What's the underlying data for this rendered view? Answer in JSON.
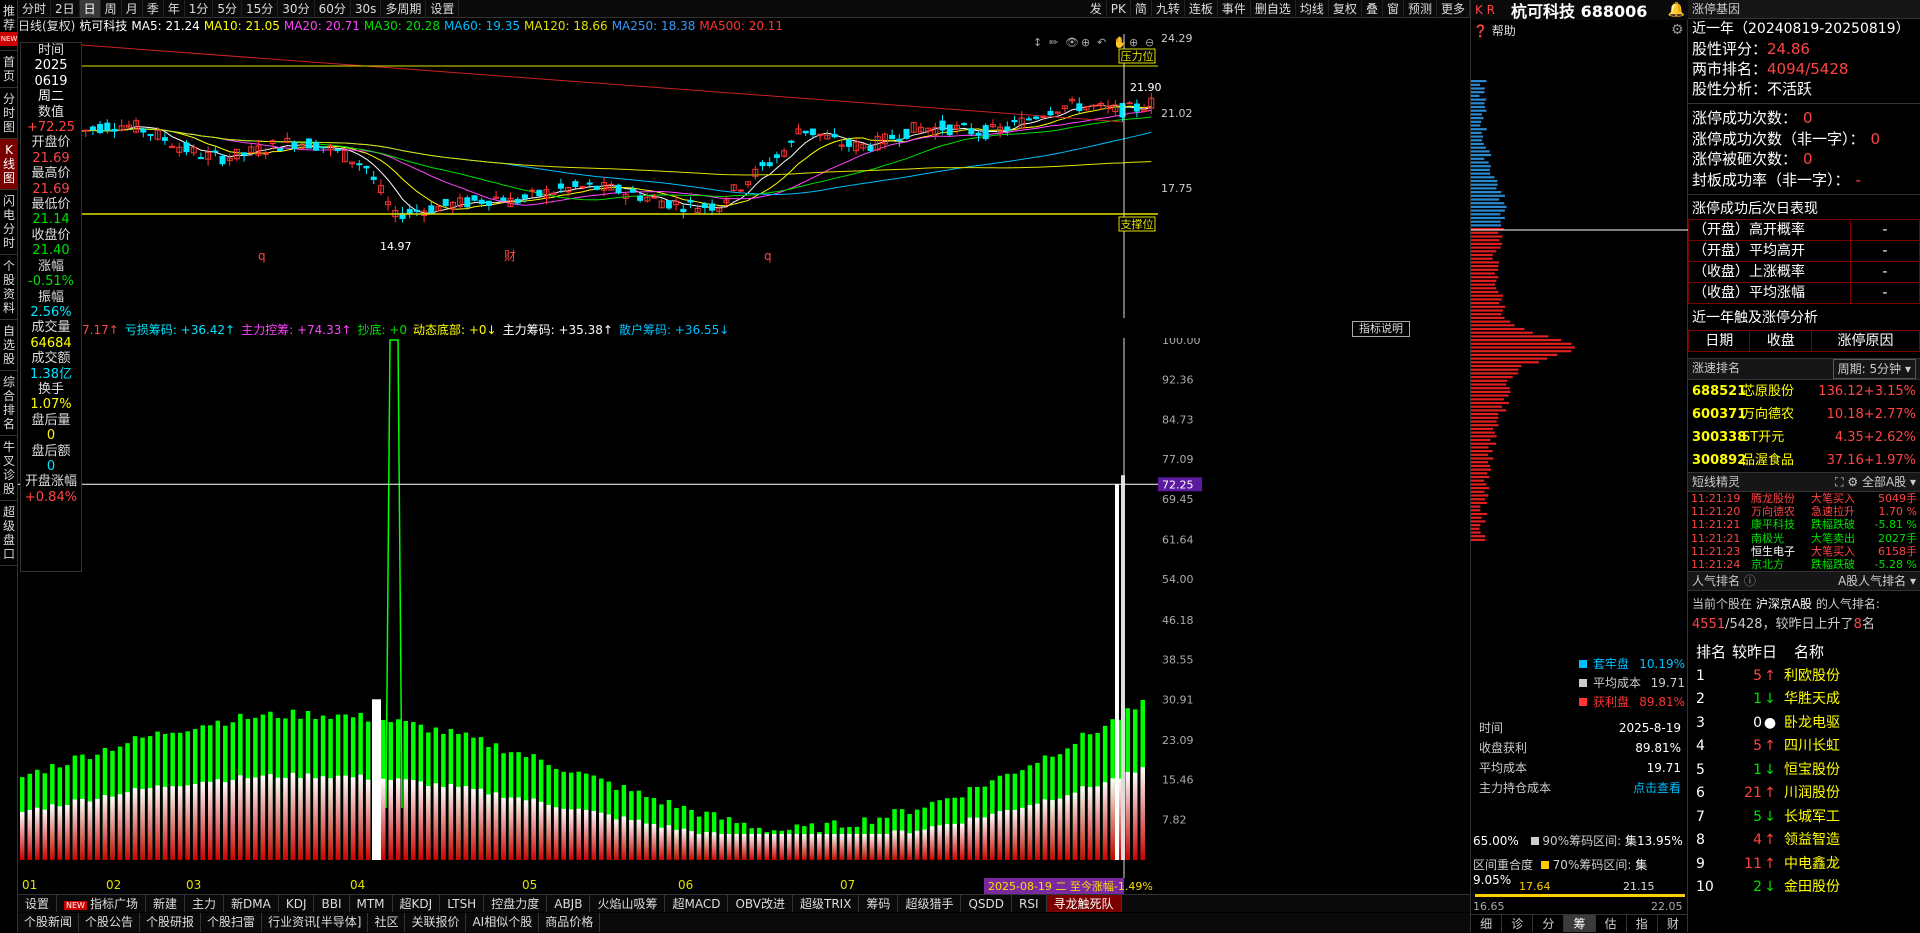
{
  "leftnav": [
    {
      "label": "推荐",
      "badge": "NEW"
    },
    {
      "label": "首页"
    },
    {
      "label": "分时图"
    },
    {
      "label": "K线图",
      "active": true
    },
    {
      "label": "闪电分时"
    },
    {
      "label": "个股资料"
    },
    {
      "label": "自选股"
    },
    {
      "label": "综合排名"
    },
    {
      "label": "牛叉诊股"
    },
    {
      "label": "超级盘口"
    }
  ],
  "toolbar": {
    "left": [
      "分时",
      "2日",
      "日",
      "周",
      "月",
      "季",
      "年",
      "1分",
      "5分",
      "15分",
      "30分",
      "60分",
      "30s",
      "多周期",
      "设置"
    ],
    "selected": "日",
    "right": [
      "发",
      "PK",
      "简",
      "九转",
      "连板",
      "事件",
      "删自选",
      "均线",
      "复权",
      "叠",
      "窗",
      "预测",
      "更多"
    ]
  },
  "maline": {
    "period": "日线(复权)",
    "name": "杭可科技",
    "items": [
      {
        "label": "MA5: 21.24",
        "color": "#ffffff"
      },
      {
        "label": "MA10: 21.05",
        "color": "#ffff00"
      },
      {
        "label": "MA20: 20.71",
        "color": "#ff44ff"
      },
      {
        "label": "MA30: 20.28",
        "color": "#00e000"
      },
      {
        "label": "MA60: 19.35",
        "color": "#00bfff"
      },
      {
        "label": "MA120: 18.66",
        "color": "#e0e000"
      },
      {
        "label": "MA250: 18.38",
        "color": "#3399ff"
      },
      {
        "label": "MA500: 20.11",
        "color": "#ff3333"
      }
    ]
  },
  "info": {
    "fields": [
      {
        "label": "时间",
        "value": "2025",
        "value2": "0619",
        "value3": "周二"
      },
      {
        "label": "数值",
        "value": "+72.25",
        "cls": "up"
      },
      {
        "label": "开盘价",
        "value": "21.69",
        "cls": "up"
      },
      {
        "label": "最高价",
        "value": "21.69",
        "cls": "up"
      },
      {
        "label": "最低价",
        "value": "21.14",
        "cls": "dn"
      },
      {
        "label": "收盘价",
        "value": "21.40",
        "cls": "dn"
      },
      {
        "label": "涨幅",
        "value": "-0.51%",
        "cls": "dn"
      },
      {
        "label": "振幅",
        "value": "2.56%",
        "cls": "cyan"
      },
      {
        "label": "成交量",
        "value": "64684",
        "cls": "yel"
      },
      {
        "label": "成交额",
        "value": "1.38亿",
        "cls": "cyan"
      },
      {
        "label": "换手",
        "value": "1.07%",
        "cls": "yel"
      },
      {
        "label": "盘后量",
        "value": "0",
        "cls": "yel"
      },
      {
        "label": "盘后额",
        "value": "0",
        "cls": "cyan"
      },
      {
        "label": "开盘涨幅",
        "value": "+0.84%",
        "cls": "up"
      }
    ]
  },
  "mainchart": {
    "yticks": [
      "24.29",
      "21.02",
      "17.75"
    ],
    "pressure_label": "压力位",
    "support_label": "支撑位",
    "high_label": "21.90",
    "low_label": "14.97",
    "months": [
      "q",
      "财",
      "q"
    ]
  },
  "indicator": {
    "title_items": [
      {
        "label": "7.17↑",
        "color": "#ff4444"
      },
      {
        "label": "亏损筹码: +36.42↑",
        "color": "#00e5ff"
      },
      {
        "label": "主力控筹: +74.33↑",
        "color": "#ff44ff"
      },
      {
        "label": "抄底: +0",
        "color": "#00e000"
      },
      {
        "label": "动态底部: +0↓",
        "color": "#ffff00"
      },
      {
        "label": "主力筹码: +35.38↑",
        "color": "#ffffff"
      },
      {
        "label": "散户筹码: +36.55↓",
        "color": "#00bfff"
      }
    ],
    "explain_label": "指标说明",
    "yticks": [
      "100.00",
      "92.36",
      "84.73",
      "77.09",
      "72.25",
      "69.45",
      "61.64",
      "54.00",
      "46.18",
      "38.55",
      "30.91",
      "23.09",
      "15.46",
      "7.82"
    ],
    "months": [
      "01",
      "02",
      "03",
      "04",
      "05",
      "06",
      "07"
    ],
    "date_tag": "2025-08-19 二 至今涨幅-1.49%"
  },
  "tabs1": [
    "设置",
    "指标广场",
    "新建",
    "主力",
    "新DMA",
    "KDJ",
    "BBI",
    "MTM",
    "超KDJ",
    "LTSH",
    "控盘力度",
    "ABJB",
    "火焰山吸筹",
    "超MACD",
    "OBV改进",
    "超级TRIX",
    "筹码",
    "超级猎手",
    "QSDD",
    "RSI",
    "寻龙触死队"
  ],
  "tabs1_new_badge": "NEW",
  "tabs2": [
    "个股新闻",
    "个股公告",
    "个股研报",
    "个股扫雷",
    "行业资讯[半导体]",
    "社区",
    "关联报价",
    "AI相似个股",
    "商品价格"
  ],
  "chip": {
    "header_left": "K R",
    "stock_name": "杭可科技 688006",
    "help": "帮助",
    "legend": [
      {
        "label": "套牢盘",
        "value": "10.19%",
        "color": "#00bfff"
      },
      {
        "label": "平均成本",
        "value": "19.71",
        "color": "#cccccc"
      },
      {
        "label": "获利盘",
        "value": "89.81%",
        "color": "#ff3333"
      }
    ],
    "stats": [
      {
        "label": "时间",
        "value": "2025-8-19"
      },
      {
        "label": "收盘获利",
        "value": "89.81%"
      },
      {
        "label": "平均成本",
        "value": "19.71"
      },
      {
        "label": "主力持仓成本",
        "value": "点击查看"
      }
    ],
    "conc90_pct": "65.00%",
    "conc90_label": "90%筹码区间:",
    "conc90_value": "集13.95%",
    "conc70_label": "区间重合度",
    "conc70_text": "70%筹码区间:",
    "conc70_value": "集 9.05%",
    "range_lo": "16.65",
    "range_a": "17.64",
    "range_b": "21.15",
    "range_hi": "22.05",
    "bottom_tabs": [
      "细",
      "诊",
      "分",
      "筹",
      "估",
      "指",
      "财"
    ]
  },
  "right": {
    "header": "涨停基因",
    "period": "近一年（20240819-20250819）",
    "rows": [
      {
        "label": "股性评分：",
        "value": "24.86"
      },
      {
        "label": "两市排名：",
        "value": "4094/5428"
      },
      {
        "label": "股性分析：",
        "value": "不活跃"
      }
    ],
    "limit_rows": [
      {
        "label": "涨停成功次数：",
        "value": "0"
      },
      {
        "label": "涨停成功次数（非一字）：",
        "value": "0"
      },
      {
        "label": "涨停被砸次数：",
        "value": "0"
      },
      {
        "label": "封板成功率（非一字）：",
        "value": "-"
      }
    ],
    "next_title": "涨停成功后次日表现",
    "next_rows": [
      {
        "label": "（开盘）高开概率",
        "value": "-"
      },
      {
        "label": "（开盘）平均高开",
        "value": "-"
      },
      {
        "label": "（收盘）上涨概率",
        "value": "-"
      },
      {
        "label": "（收盘）平均涨幅",
        "value": "-"
      }
    ],
    "touch_title": "近一年触及涨停分析",
    "touch_cols": [
      "日期",
      "收盘",
      "涨停原因"
    ],
    "speed_title": "涨速排名",
    "speed_period": "周期: 5分钟",
    "speed": [
      {
        "code": "688521",
        "name": "芯原股份",
        "price": "136.12",
        "chg": "+3.15%"
      },
      {
        "code": "600371",
        "name": "万向德农",
        "price": "10.18",
        "chg": "+2.77%"
      },
      {
        "code": "300338",
        "name": "ST开元",
        "price": "4.35",
        "chg": "+2.62%"
      },
      {
        "code": "300892",
        "name": "品渥食品",
        "price": "37.16",
        "chg": "+1.97%"
      }
    ],
    "flash_title": "短线精灵",
    "flash_filter": "全部A股",
    "flash": [
      {
        "time": "11:21:19",
        "name": "腾龙股份",
        "act": "大笔买入",
        "val": "5049手",
        "color": "#ff4444"
      },
      {
        "time": "11:21:20",
        "name": "万向德农",
        "act": "急速拉升",
        "val": "1.70 %",
        "color": "#ff4444"
      },
      {
        "time": "11:21:21",
        "name": "康平科技",
        "act": "跌幅跌破",
        "val": "-5.81 %",
        "color": "#00e000"
      },
      {
        "time": "11:21:21",
        "name": "南极光",
        "act": "大笔卖出",
        "val": "2027手",
        "color": "#00e000"
      },
      {
        "time": "11:21:23",
        "name": "恒生电子",
        "act": "大笔买入",
        "val": "6158手",
        "color": "#ff4444"
      },
      {
        "time": "11:21:24",
        "name": "京北方",
        "act": "跌幅跌破",
        "val": "-5.28 %",
        "color": "#00e000"
      }
    ],
    "pop_title": "人气排名",
    "pop_filter": "A股人气排名",
    "pop_text1": "当前个股在",
    "pop_market": "沪深京A股",
    "pop_text2": "的人气排名:",
    "pop_rank": "4551",
    "pop_total": "/5428，较昨日上升了",
    "pop_up": "8",
    "pop_unit": "名",
    "rank_cols": [
      "排名",
      "较昨日",
      "名称"
    ],
    "ranks": [
      {
        "n": "1",
        "c": "5",
        "dir": "up",
        "name": "利欧股份"
      },
      {
        "n": "2",
        "c": "1",
        "dir": "dn",
        "name": "华胜天成"
      },
      {
        "n": "3",
        "c": "0",
        "dir": "flat",
        "name": "卧龙电驱"
      },
      {
        "n": "4",
        "c": "5",
        "dir": "up",
        "name": "四川长虹"
      },
      {
        "n": "5",
        "c": "1",
        "dir": "dn",
        "name": "恒宝股份"
      },
      {
        "n": "6",
        "c": "21",
        "dir": "up",
        "name": "川润股份"
      },
      {
        "n": "7",
        "c": "5",
        "dir": "dn",
        "name": "长城军工"
      },
      {
        "n": "8",
        "c": "4",
        "dir": "up",
        "name": "领益智造"
      },
      {
        "n": "9",
        "c": "11",
        "dir": "up",
        "name": "中电鑫龙"
      },
      {
        "n": "10",
        "c": "2",
        "dir": "dn",
        "name": "金田股份"
      }
    ]
  }
}
